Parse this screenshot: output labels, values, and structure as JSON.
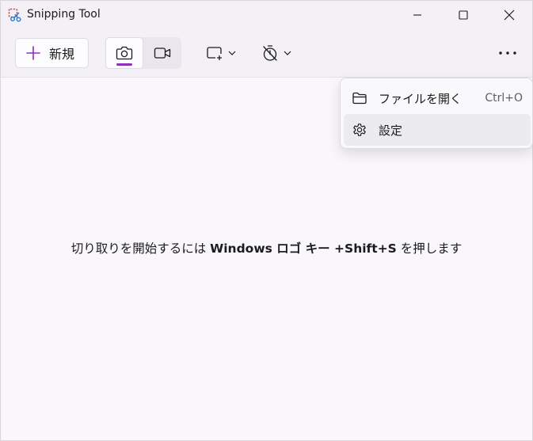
{
  "window": {
    "title": "Snipping Tool"
  },
  "toolbar": {
    "new_label": "新規",
    "accent": "#8e2fb8"
  },
  "menu": {
    "items": [
      {
        "label": "ファイルを開く",
        "shortcut": "Ctrl+O",
        "icon": "folder-icon"
      },
      {
        "label": "設定",
        "icon": "gear-icon"
      }
    ]
  },
  "content": {
    "hint_prefix": "切り取りを開始するには ",
    "hint_bold": "Windows ロゴ キー +Shift+S",
    "hint_suffix": " を押します"
  }
}
